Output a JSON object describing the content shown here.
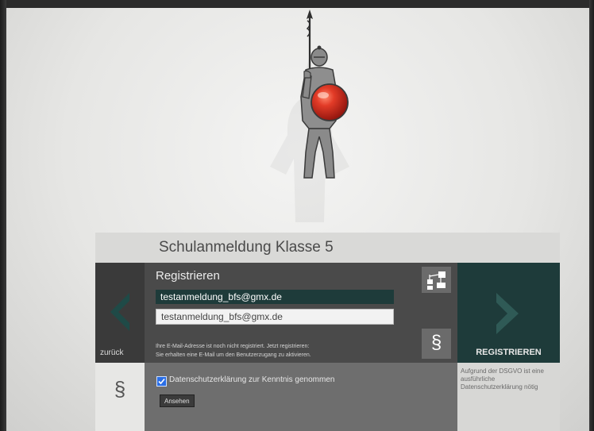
{
  "app": {
    "title": "Schulanmeldung Klasse 5"
  },
  "register_panel": {
    "heading": "Registrieren",
    "email_value": "testanmeldung_bfs@gmx.de",
    "email_confirm_value": "testanmeldung_bfs@gmx.de",
    "hint_line1": "Ihre E-Mail-Adresse ist noch nicht registriert. Jetzt registrieren:",
    "hint_line2": "Sie erhalten eine E-Mail um den Benutzerzugang zu aktivieren."
  },
  "nav": {
    "back_label": "zurück",
    "register_label": "REGISTRIEREN"
  },
  "consent": {
    "paragraph_symbol": "§",
    "checkbox_checked": true,
    "checkbox_label": "Datenschutzerklärung zur Kenntnis genommen",
    "view_button_label": "Ansehen"
  },
  "dsgvo": {
    "note": "Aufgrund der DSGVO ist eine ausführliche Datenschutzerklärung nötig"
  },
  "icons": {
    "org_chart": "org-chart-icon",
    "paragraph": "§"
  },
  "colors": {
    "accent_dark_teal": "#1e3b3a",
    "panel_gray": "#4a4a4a",
    "shield_red": "#d3281c"
  }
}
